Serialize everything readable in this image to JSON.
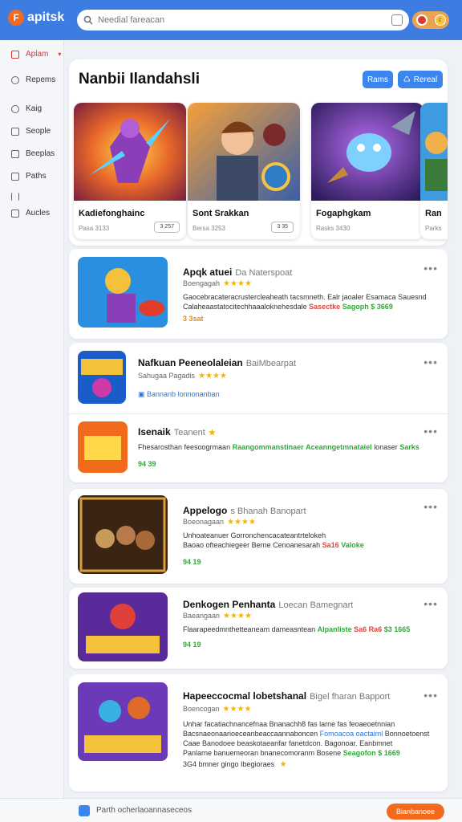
{
  "app": {
    "logo_text": "apitsk",
    "logo_mark": "F"
  },
  "search": {
    "placeholder": "Needial fareacan"
  },
  "sidebar": {
    "items": [
      {
        "label": "Aplam",
        "icon": "app-icon",
        "active": true
      },
      {
        "label": "Repems",
        "icon": "search-icon"
      },
      {
        "label": "Kaig",
        "icon": "clock-icon"
      },
      {
        "label": "Seople",
        "icon": "chat-icon"
      },
      {
        "label": "Beeplas",
        "icon": "box-icon"
      },
      {
        "label": "Paths",
        "icon": "path-icon"
      },
      {
        "label": "",
        "icon": "bars-icon"
      },
      {
        "label": "Aucles",
        "icon": "plus-icon"
      }
    ]
  },
  "featured": {
    "title": "Nanbii Ilandahsli",
    "btn1": "Rams",
    "btn2": "Rereal",
    "cards": [
      {
        "name": "Kadiefonghainc",
        "meta": "Pasa 3133",
        "btn": "3 257"
      },
      {
        "name": "Sont Srakkan",
        "meta": "Bersa 3253",
        "btn": "3 35"
      },
      {
        "name": "Fogaphgkam",
        "meta": "Rasks 3430",
        "btn": ""
      },
      {
        "name": "Ran",
        "meta": "Parks",
        "btn": ""
      }
    ]
  },
  "list": [
    {
      "title": "Apqk atuei",
      "sub": "Da Naterspoat",
      "rating_label": "Boengagah",
      "desc_lines": [
        "Gaocebracateracrustercleaheath tacsmneth. Ealr jaoaler Esamaca Sauesnd",
        "Calaheaastatocitechhaaaloknehesdale"
      ],
      "desc_tags": [
        {
          "text": "Sasectke",
          "color": "red"
        },
        {
          "text": "Sagoph",
          "color": "green"
        },
        {
          "text": "$ 3669",
          "color": "green"
        }
      ],
      "extra": "3 3sat"
    },
    {
      "title": "Nafkuan Peeneolaleian",
      "sub": "BaiMbearpat",
      "rating_label": "Sahugaa Pagadis",
      "desc_lines": [],
      "desc_tags": [],
      "link": "Bannanb lonnonanban",
      "extra": ""
    },
    {
      "title": "Isenaik",
      "sub": "Teanent",
      "rating_label": "",
      "desc_lines": [
        "Fhesarosthan feesoogrmaan"
      ],
      "desc_tags": [
        {
          "text": "Raangommanstinaer",
          "color": "green"
        },
        {
          "text": "Aceanngetmnataiel",
          "color": "green"
        },
        {
          "text": "lonaser",
          "color": "plain"
        },
        {
          "text": "Sarks",
          "color": "green"
        }
      ],
      "extra": "94 39"
    },
    {
      "title": "Appelogo",
      "sub": "s Bhanah Banopart",
      "rating_label": "Boeonagaan",
      "desc_lines": [
        "Unhoateanuer Gorronchencacateantrtelokeh",
        "Baoao ofteachiegeer Berne Cenoanesarah"
      ],
      "desc_tags": [
        {
          "text": "Sa16",
          "color": "red"
        },
        {
          "text": "Valoke",
          "color": "green"
        }
      ],
      "extra": "94 19"
    },
    {
      "title": "Denkogen Penhanta",
      "sub": "Loecan Bamegnart",
      "rating_label": "Baeangaan",
      "desc_lines": [
        "Flaarapeedmnthetteaneam dameasntean"
      ],
      "desc_tags": [
        {
          "text": "Alpanliste",
          "color": "green"
        },
        {
          "text": "Sa6 Ra6",
          "color": "red"
        },
        {
          "text": "$3 1665",
          "color": "green"
        }
      ],
      "extra": "94 19"
    },
    {
      "title": "Hapeeccocmal lobetshanal",
      "sub": "Bigel fharan Bapport",
      "rating_label": "Boencogan",
      "desc_lines": [
        "Unhar facatiachnancefnaa Bnanachh8 fas larne fas feoaeoetnnian",
        "Bacsnaeonaarioeceanbeaccaannaboncen",
        "Caae Banodoee beaskotaeanfar fanetdcon. Bagonoar. Eanbmnet",
        "Panlarne banuemeoran bnanecomoranm Bosene"
      ],
      "desc_tags": [
        {
          "text": "Fomoacoa oactaiml",
          "color": "blue"
        },
        {
          "text": "Bonnoetoenst",
          "color": "plain"
        },
        {
          "text": "Seagofon",
          "color": "green"
        },
        {
          "text": "$ 1669",
          "color": "green"
        }
      ],
      "extra": "3G4 bmner gingo Ibegioraes"
    }
  ],
  "footer": {
    "text": "Parth ocherlaoannaseceos",
    "button": "Bianbanoee"
  },
  "colors": {
    "accent": "#3d7ce0",
    "brand_orange": "#f36b21",
    "green": "#2eaa36",
    "red": "#e0453a",
    "star": "#f4b400"
  }
}
